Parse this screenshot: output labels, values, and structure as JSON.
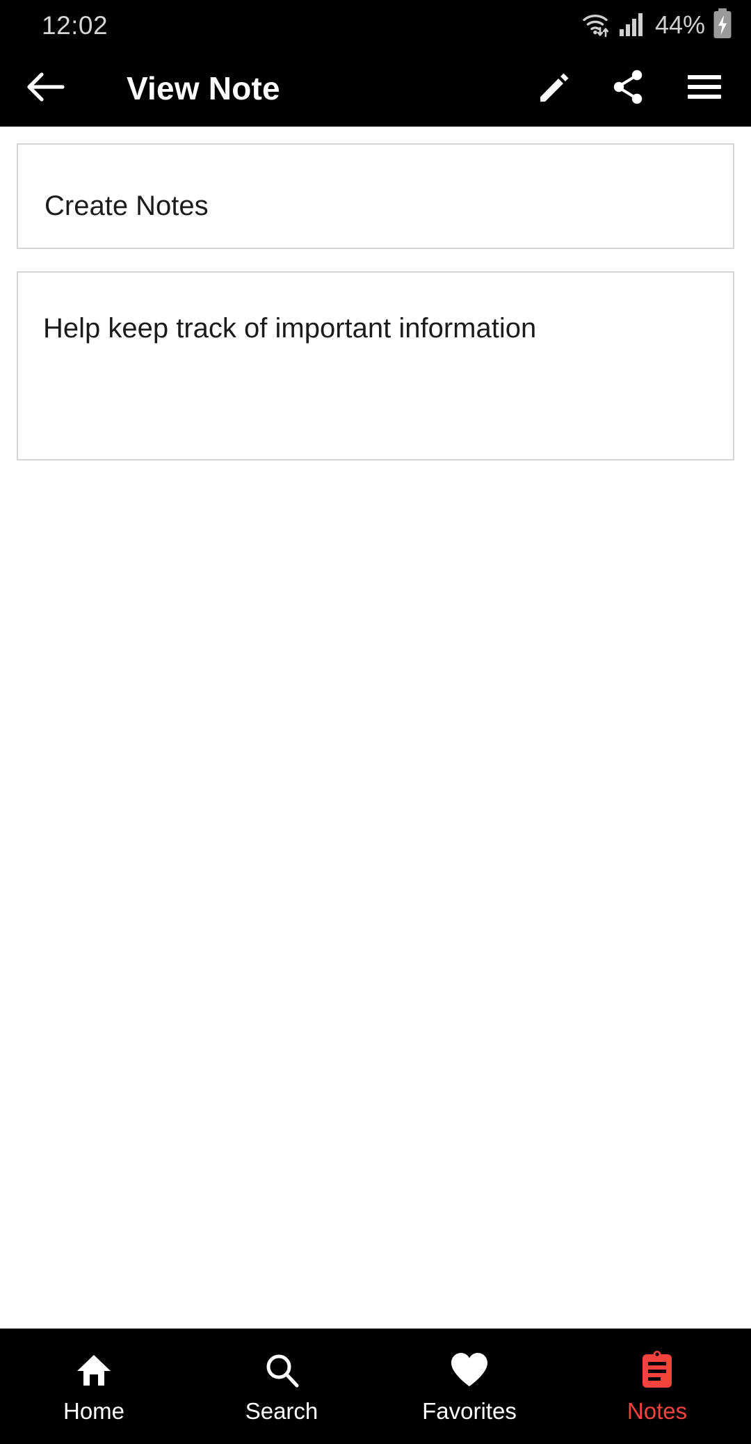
{
  "status_bar": {
    "time": "12:02",
    "battery_percent": "44%",
    "icons": [
      "wifi-icon",
      "cellular-signal-icon",
      "battery-charging-icon"
    ]
  },
  "app_bar": {
    "title": "View Note",
    "back_icon": "arrow-back-icon",
    "actions": [
      {
        "name": "edit-button",
        "icon": "pencil-icon"
      },
      {
        "name": "share-button",
        "icon": "share-icon"
      },
      {
        "name": "menu-button",
        "icon": "hamburger-menu-icon"
      }
    ]
  },
  "note": {
    "title": "Create Notes",
    "body": "Help keep track of important information"
  },
  "bottom_nav": {
    "active_color": "#f4433d",
    "inactive_color": "#ffffff",
    "items": [
      {
        "label": "Home",
        "icon": "home-icon",
        "active": false
      },
      {
        "label": "Search",
        "icon": "search-icon",
        "active": false
      },
      {
        "label": "Favorites",
        "icon": "heart-icon",
        "active": false
      },
      {
        "label": "Notes",
        "icon": "clipboard-icon",
        "active": true
      }
    ]
  }
}
